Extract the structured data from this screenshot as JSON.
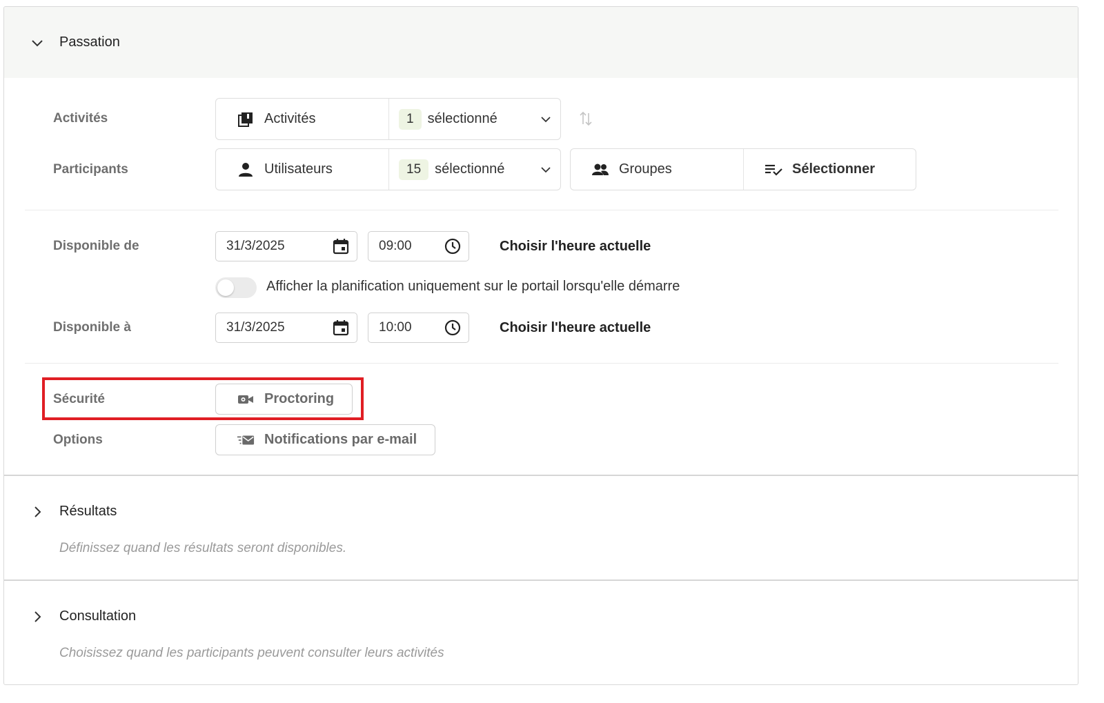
{
  "sections": {
    "passation": {
      "title": "Passation",
      "expanded": true
    },
    "resultats": {
      "title": "Résultats",
      "subtitle": "Définissez quand les résultats seront disponibles.",
      "expanded": false
    },
    "consultation": {
      "title": "Consultation",
      "subtitle": "Choisissez quand les participants peuvent consulter leurs activités",
      "expanded": false
    }
  },
  "activites": {
    "label": "Activités",
    "selector_label": "Activités",
    "count": "1",
    "count_suffix": "sélectionné"
  },
  "participants": {
    "label": "Participants",
    "users_label": "Utilisateurs",
    "count": "15",
    "count_suffix": "sélectionné",
    "groups_label": "Groupes",
    "select_label": "Sélectionner"
  },
  "disponible_de": {
    "label": "Disponible de",
    "date": "31/3/2025",
    "time": "09:00",
    "action": "Choisir l'heure actuelle"
  },
  "toggle": {
    "label": "Afficher la planification uniquement sur le portail lorsqu'elle démarre",
    "on": false
  },
  "disponible_a": {
    "label": "Disponible à",
    "date": "31/3/2025",
    "time": "10:00",
    "action": "Choisir l'heure actuelle"
  },
  "securite": {
    "label": "Sécurité",
    "button": "Proctoring"
  },
  "options": {
    "label": "Options",
    "button": "Notifications par e-mail"
  },
  "colors": {
    "badge_bg": "#eef4e3",
    "highlight": "#e01e24",
    "header_bg": "#f6f7f5"
  }
}
